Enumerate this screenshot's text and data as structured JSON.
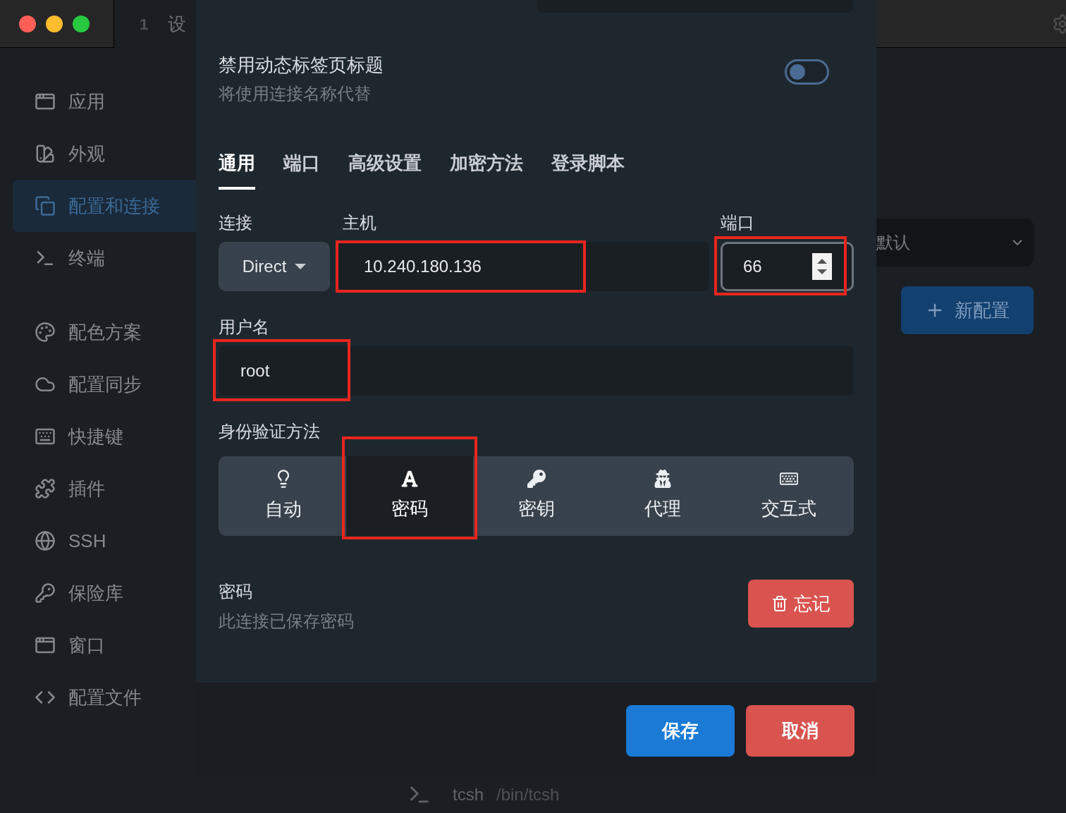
{
  "titlebar": {
    "tab_number": "1",
    "tab_title": "设"
  },
  "sidebar": {
    "groups": [
      [
        {
          "label": "应用",
          "selected": false
        },
        {
          "label": "外观",
          "selected": false
        },
        {
          "label": "配置和连接",
          "selected": true
        },
        {
          "label": "终端",
          "selected": false
        }
      ],
      [
        {
          "label": "配色方案",
          "selected": false
        },
        {
          "label": "配置同步",
          "selected": false
        },
        {
          "label": "快捷键",
          "selected": false
        },
        {
          "label": "插件",
          "selected": false
        },
        {
          "label": "SSH",
          "selected": false
        },
        {
          "label": "保险库",
          "selected": false
        },
        {
          "label": "窗口",
          "selected": false
        },
        {
          "label": "配置文件",
          "selected": false
        }
      ]
    ]
  },
  "modal": {
    "dynamic_title": {
      "title": "禁用动态标签页标题",
      "subtitle": "将使用连接名称代替",
      "on": false
    },
    "tabs": [
      {
        "label": "通用",
        "selected": true
      },
      {
        "label": "端口",
        "selected": false
      },
      {
        "label": "高级设置",
        "selected": false
      },
      {
        "label": "加密方法",
        "selected": false
      },
      {
        "label": "登录脚本",
        "selected": false
      }
    ],
    "connection": {
      "label": "连接",
      "value": "Direct"
    },
    "host": {
      "label": "主机",
      "value": "10.240.180.136"
    },
    "port": {
      "label": "端口",
      "value": "66"
    },
    "username": {
      "label": "用户名",
      "value": "root"
    },
    "auth": {
      "label": "身份验证方法",
      "methods": [
        {
          "label": "自动",
          "selected": false
        },
        {
          "label": "密码",
          "selected": true
        },
        {
          "label": "密钥",
          "selected": false
        },
        {
          "label": "代理",
          "selected": false
        },
        {
          "label": "交互式",
          "selected": false
        }
      ]
    },
    "password": {
      "title": "密码",
      "subtitle": "此连接已保存密码",
      "forget_button": "忘记"
    },
    "buttons": {
      "save": "保存",
      "cancel": "取消"
    }
  },
  "background": {
    "profile_select": "默认",
    "new_profile_button": "新配置",
    "shell": {
      "name": "tcsh",
      "path": "/bin/tcsh"
    }
  }
}
